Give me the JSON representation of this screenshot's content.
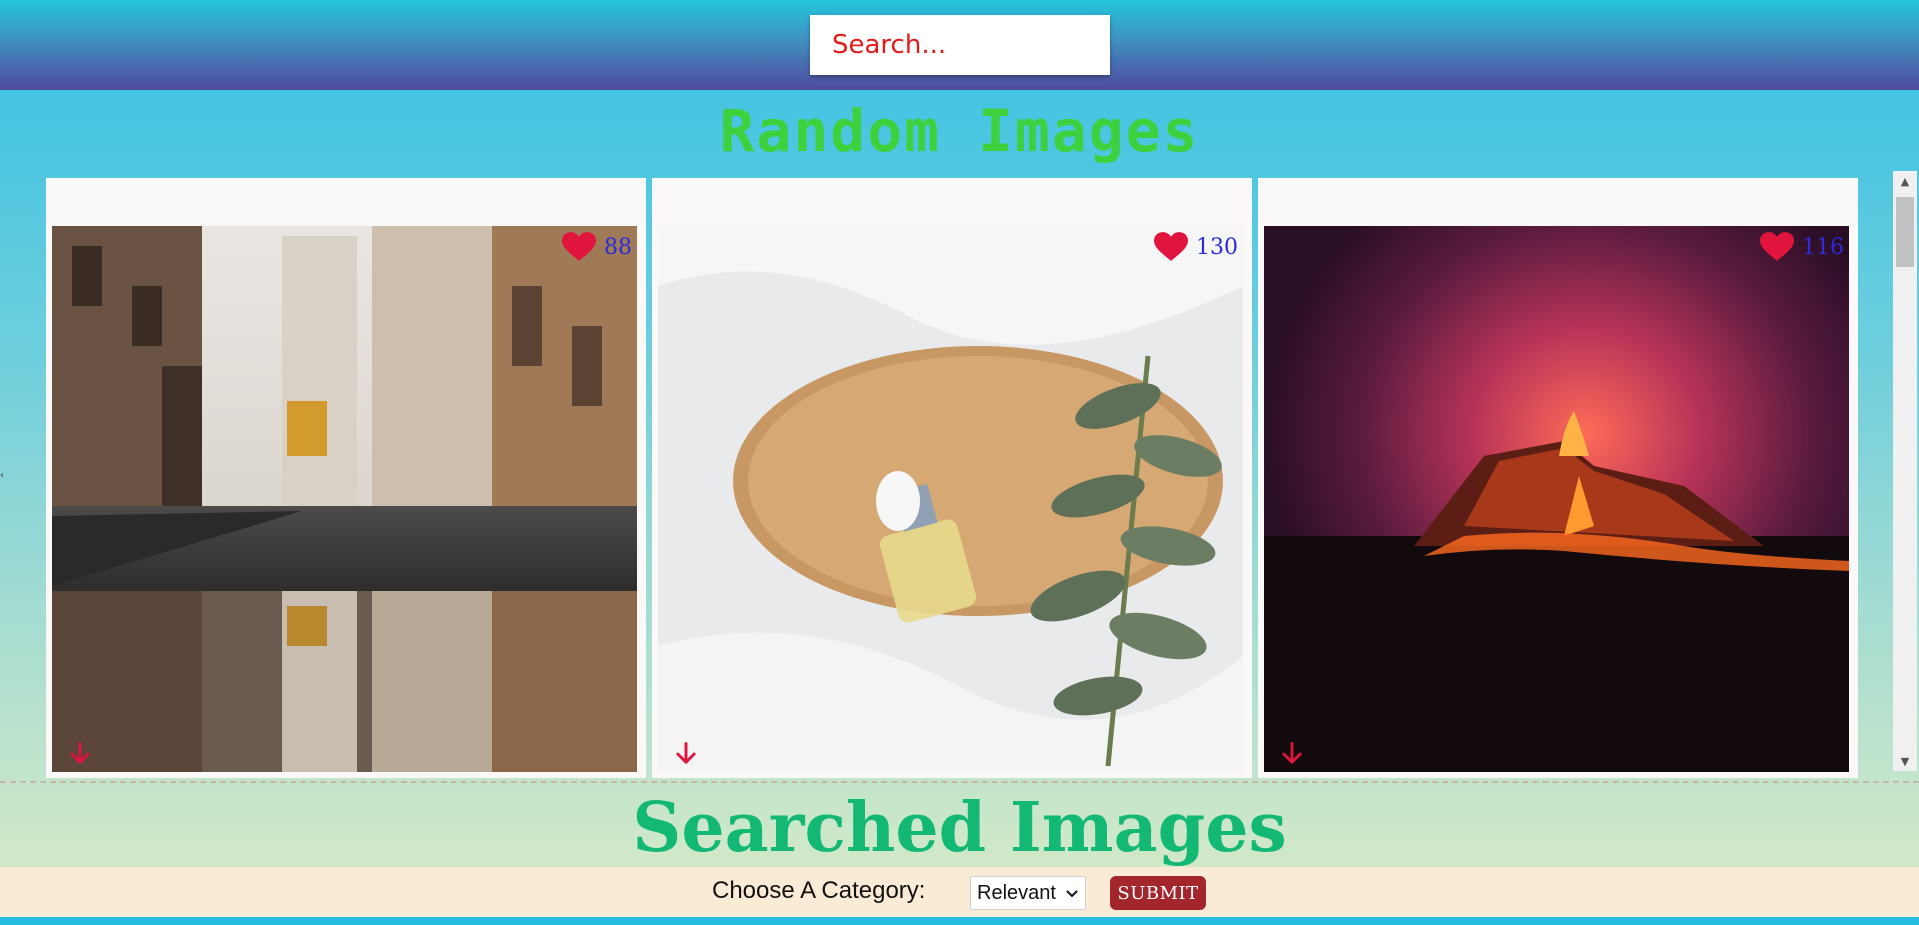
{
  "header": {
    "search_placeholder": "Search..."
  },
  "random_section": {
    "title": "Random Images",
    "cards": [
      {
        "likes": "88",
        "photo_icon": "street-reflection-photo"
      },
      {
        "likes": "130",
        "photo_icon": "serum-bottle-photo"
      },
      {
        "likes": "116",
        "photo_icon": "volcano-eruption-photo"
      }
    ]
  },
  "searched_section": {
    "title": "Searched Images"
  },
  "category_bar": {
    "label": "Choose A Category:",
    "selected": "Relevant",
    "submit_label": "SUBMIT"
  },
  "colors": {
    "accent_red": "#e0143c",
    "random_title": "#3fd13d",
    "searched_title": "#12b873",
    "submit_bg": "#a3262d",
    "likes_text": "#2b2bd9"
  }
}
